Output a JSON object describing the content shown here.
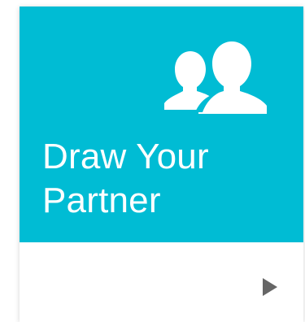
{
  "card": {
    "title_line1": "Draw Your",
    "title_line2": "Partner",
    "icon": "users-icon",
    "action_icon": "play-icon"
  },
  "colors": {
    "accent": "#00bcd4",
    "text": "#ffffff",
    "play_icon": "#666666"
  }
}
